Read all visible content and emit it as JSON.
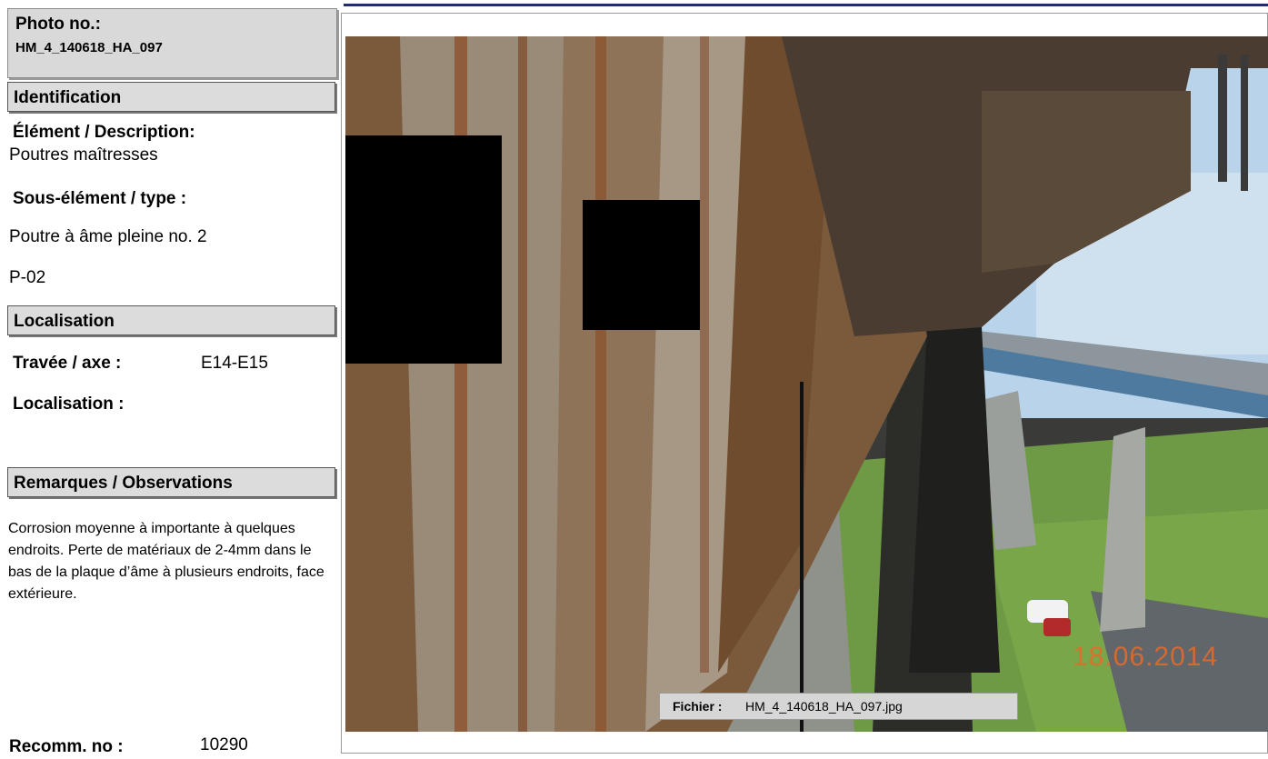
{
  "photo": {
    "label": "Photo no.:",
    "number": "HM_4_140618_HA_097"
  },
  "identification": {
    "header": "Identification",
    "element_label": "Élément / Description:",
    "element_value": "Poutres maîtresses",
    "subelement_label": "Sous-élément / type :",
    "subelement_value": "Poutre à âme pleine no. 2",
    "code": "P-02"
  },
  "localisation": {
    "header": "Localisation",
    "travee_label": "Travée / axe :",
    "travee_value": "E14-E15",
    "localisation_label": "Localisation :"
  },
  "remarques": {
    "header": "Remarques / Observations",
    "text": "Corrosion moyenne à importante à quelques endroits. Perte de matériaux de 2-4mm dans le bas de la plaque d’âme à plusieurs endroits, face extérieure."
  },
  "recommandation": {
    "label": "Recomm. no :",
    "value": "10290"
  },
  "image": {
    "file_label": "Fichier :",
    "file_name": "HM_4_140618_HA_097.jpg",
    "date_stamp": "18.06.2014"
  }
}
